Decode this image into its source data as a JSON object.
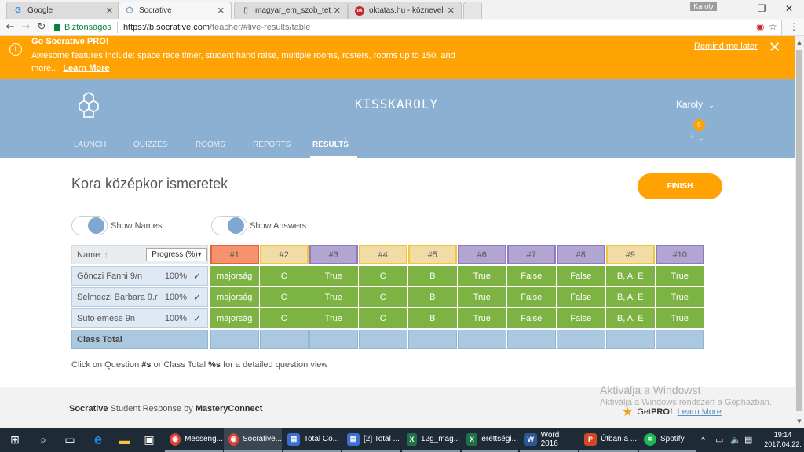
{
  "browser": {
    "tabs": [
      {
        "label": "Google",
        "icon": "google-icon",
        "active": false
      },
      {
        "label": "Socrative",
        "icon": "socrative-icon",
        "active": true
      },
      {
        "label": "magyar_em_szob_tetelc",
        "icon": "document-icon",
        "active": false
      },
      {
        "label": "oktatas.hu - köznevelési",
        "icon": "oktatas-icon",
        "active": false
      }
    ],
    "profile_name": "Karoly",
    "security_label": "Biztonságos",
    "url_host": "https://b.socrative.com",
    "url_path": "/teacher/#live-results/table"
  },
  "promo": {
    "title": "Go Socrative PRO!",
    "message": "Awesome features include: space race timer, student hand raise, multiple rooms, rosters, rooms up to 150, and more...",
    "learn_more": "Learn More",
    "remind_later": "Remind me later"
  },
  "header": {
    "room_name": "KISSKAROLY",
    "user_name": "Karoly",
    "hand_raise_count": "0",
    "nav": [
      {
        "label": "LAUNCH",
        "active": false
      },
      {
        "label": "QUIZZES",
        "active": false
      },
      {
        "label": "ROOMS",
        "active": false
      },
      {
        "label": "REPORTS",
        "active": false
      },
      {
        "label": "RESULTS",
        "active": true
      }
    ]
  },
  "main": {
    "quiz_title": "Kora középkor ismeretek",
    "finish_label": "FINISH",
    "toggles": [
      {
        "label": "Show Names",
        "on": true
      },
      {
        "label": "Show Answers",
        "on": true
      }
    ],
    "table": {
      "name_header": "Name",
      "sort_arrow": "↑",
      "progress_select": "Progress (%)",
      "questions": [
        {
          "label": "#1",
          "color": "#f7926f",
          "border": "#e0623a"
        },
        {
          "label": "#2",
          "color": "#f2dca6",
          "border": "#f0c63a"
        },
        {
          "label": "#3",
          "color": "#b3a5d2",
          "border": "#8f79c4"
        },
        {
          "label": "#4",
          "color": "#f2dca6",
          "border": "#f0c63a"
        },
        {
          "label": "#5",
          "color": "#f2dca6",
          "border": "#f0c63a"
        },
        {
          "label": "#6",
          "color": "#b3a5d2",
          "border": "#8f79c4"
        },
        {
          "label": "#7",
          "color": "#b3a5d2",
          "border": "#8f79c4"
        },
        {
          "label": "#8",
          "color": "#b3a5d2",
          "border": "#8f79c4"
        },
        {
          "label": "#9",
          "color": "#f2dca6",
          "border": "#f0c63a"
        },
        {
          "label": "#10",
          "color": "#b3a5d2",
          "border": "#8f79c4"
        }
      ],
      "students": [
        {
          "name": "Gönczi Fanni 9/n",
          "progress": "100%",
          "answers": [
            "majorság",
            "C",
            "True",
            "C",
            "B",
            "True",
            "False",
            "False",
            "B, A, E",
            "True"
          ]
        },
        {
          "name": "Selmeczi Barbara 9.r",
          "progress": "100%",
          "answers": [
            "majorság",
            "C",
            "True",
            "C",
            "B",
            "True",
            "False",
            "False",
            "B, A, E",
            "True"
          ]
        },
        {
          "name": "Suto emese 9n",
          "progress": "100%",
          "answers": [
            "majorság",
            "C",
            "True",
            "C",
            "B",
            "True",
            "False",
            "False",
            "B, A, E",
            "True"
          ]
        }
      ],
      "class_total_label": "Class Total",
      "class_totals": [
        "",
        "",
        "",
        "",
        "",
        "",
        "",
        "",
        "",
        ""
      ]
    },
    "hint_prefix": "Click on Question ",
    "hint_b1": "#s",
    "hint_mid": " or Class Total ",
    "hint_b2": "%s",
    "hint_suffix": " for a detailed question view"
  },
  "footer": {
    "brand": "Socrative",
    "middle": " Student Response by ",
    "company": "MasteryConnect",
    "get": "Get ",
    "pro": "PRO!",
    "learn_more": "Learn More"
  },
  "watermark": {
    "line1": "Aktiválja a Windowst",
    "line2": "Aktiválja a Windows rendszert a Gépházban."
  },
  "taskbar": {
    "apps": [
      {
        "label": "Messeng...",
        "icon": "chrome-icon",
        "color": "#db4437",
        "active": false
      },
      {
        "label": "Socrative...",
        "icon": "chrome-icon",
        "color": "#db4437",
        "active": true
      },
      {
        "label": "Total Co...",
        "icon": "floppy-icon",
        "color": "#3b6fd1",
        "active": false
      },
      {
        "label": "[2] Total ...",
        "icon": "floppy-icon",
        "color": "#3b6fd1",
        "active": false
      },
      {
        "label": "12g_mag...",
        "icon": "excel-icon",
        "color": "#1e7145",
        "active": false
      },
      {
        "label": "érettségi...",
        "icon": "excel-icon",
        "color": "#1e7145",
        "active": false
      },
      {
        "label": "Word 2016",
        "icon": "word-icon",
        "color": "#2b579a",
        "active": false
      },
      {
        "label": "Útban a ...",
        "icon": "powerpoint-icon",
        "color": "#d24726",
        "active": false
      },
      {
        "label": "Spotify",
        "icon": "spotify-icon",
        "color": "#1db954",
        "active": false
      }
    ],
    "time": "19:14",
    "date": "2017.04.22."
  }
}
